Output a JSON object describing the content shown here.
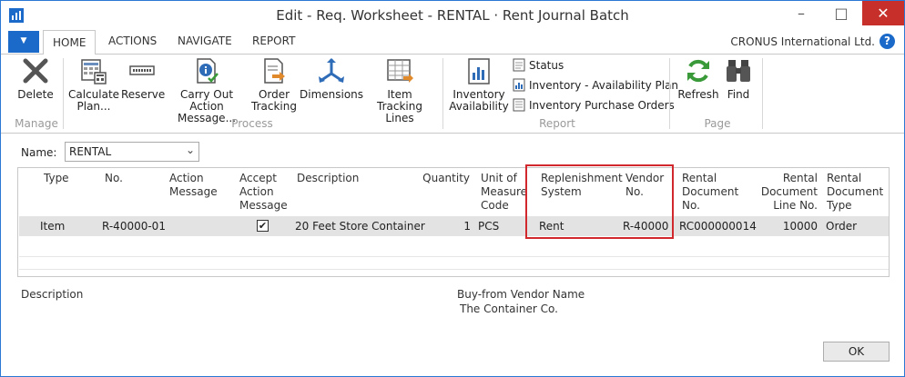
{
  "window": {
    "title": "Edit - Req. Worksheet - RENTAL · Rent Journal Batch"
  },
  "ribbon_tabs": [
    "HOME",
    "ACTIONS",
    "NAVIGATE",
    "REPORT"
  ],
  "company": "CRONUS International Ltd.",
  "help_glyph": "?",
  "ribbon": {
    "manage": {
      "label": "Manage",
      "delete": "Delete"
    },
    "process": {
      "label": "Process",
      "calculate_plan": [
        "Calculate",
        "Plan..."
      ],
      "reserve": "Reserve",
      "carry_out": [
        "Carry Out Action",
        "Message..."
      ],
      "order_tracking": [
        "Order",
        "Tracking"
      ],
      "dimensions": "Dimensions",
      "item_tracking": [
        "Item",
        "Tracking Lines"
      ]
    },
    "report": {
      "label": "Report",
      "inventory_availability": [
        "Inventory",
        "Availability"
      ],
      "status": "Status",
      "inv_avail_plan": "Inventory - Availability Plan",
      "inv_purchase_orders": "Inventory Purchase Orders"
    },
    "page": {
      "label": "Page",
      "refresh": "Refresh",
      "find": "Find"
    }
  },
  "filter": {
    "name_label": "Name:",
    "name_value": "RENTAL"
  },
  "grid": {
    "headers": {
      "type": "Type",
      "no": "No.",
      "action_message": [
        "Action",
        "Message"
      ],
      "accept_action_message": [
        "Accept",
        "Action",
        "Message"
      ],
      "description": "Description",
      "quantity": "Quantity",
      "uom": [
        "Unit of",
        "Measure",
        "Code"
      ],
      "replenishment": [
        "Replenishment",
        "System"
      ],
      "vendor_no": [
        "Vendor",
        "No."
      ],
      "rental_doc_no": [
        "Rental",
        "Document",
        "No."
      ],
      "rental_doc_line": [
        "Rental",
        "Document",
        "Line No."
      ],
      "rental_doc_type": [
        "Rental",
        "Document",
        "Type"
      ]
    },
    "rows": [
      {
        "type": "Item",
        "no": "R-40000-01",
        "accept": true,
        "description": "20 Feet Store Container",
        "quantity": "1",
        "uom": "PCS",
        "replenishment": "Rent",
        "vendor_no": "R-40000",
        "rental_doc_no": "RC000000014",
        "rental_doc_line": "10000",
        "rental_doc_type": "Order"
      }
    ]
  },
  "factbox": {
    "description_label": "Description",
    "buy_from_label": "Buy-from Vendor Name",
    "buy_from_value": "The Container Co."
  },
  "ok_button": "OK",
  "colors": {
    "accent": "#1b6ac9",
    "close": "#c7302a",
    "highlight": "#d0282c",
    "row_selected": "#e3e3e3"
  }
}
